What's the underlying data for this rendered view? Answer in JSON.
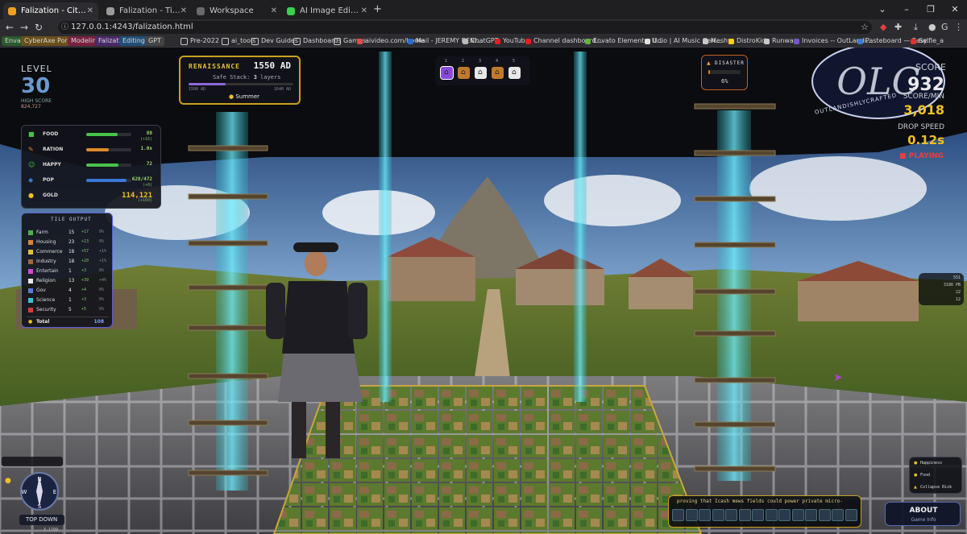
{
  "browser": {
    "tabs": [
      {
        "title": "Falization - City Builder v0.",
        "active": true,
        "favicon_color": "#f0a020"
      },
      {
        "title": "Falization - Tile Manager v1.3.1",
        "active": false,
        "favicon_color": "#9a9a9a"
      },
      {
        "title": "Workspace",
        "active": false,
        "favicon_color": "#6a6a6a"
      },
      {
        "title": "AI Image Editor - Transform & ",
        "active": false,
        "favicon_color": "#37d14a"
      }
    ],
    "new_tab": "+",
    "url": "127.0.0.1:4243/falization.html",
    "window_controls": [
      "⌄",
      "–",
      "❐",
      "✕"
    ],
    "bookmarks": [
      {
        "label": "Envato",
        "style": "chip",
        "color": "#2a5a2a"
      },
      {
        "label": "CyberAxe Portfolio",
        "style": "chip",
        "color": "#6b4f1a"
      },
      {
        "label": "Modeling",
        "style": "chip",
        "color": "#7a2040"
      },
      {
        "label": "Falization",
        "style": "chip",
        "color": "#4a2a6a"
      },
      {
        "label": "Editing",
        "style": "chip",
        "color": "#1f4f7a"
      },
      {
        "label": "GPT",
        "style": "chip",
        "color": "#444"
      },
      {
        "label": "Pre-2022",
        "style": "folder",
        "color": "#c9c9c9"
      },
      {
        "label": "ai_tools",
        "style": "folder",
        "color": "#c9c9c9"
      },
      {
        "label": "Dev Guides",
        "style": "folder",
        "color": "#c9c9c9"
      },
      {
        "label": "Dashboards",
        "style": "folder",
        "color": "#c9c9c9"
      },
      {
        "label": "Games",
        "style": "folder",
        "color": "#c9c9c9"
      },
      {
        "label": "aivideo.com/home",
        "style": "link",
        "color": "#e14b4b"
      },
      {
        "label": "Mail - JEREMY BENI...",
        "style": "link",
        "color": "#2a6bd1"
      },
      {
        "label": "ChatGPT",
        "style": "link",
        "color": "#bbbbbb"
      },
      {
        "label": "YouTube",
        "style": "link",
        "color": "#e02020"
      },
      {
        "label": "Channel dashboard...",
        "style": "link",
        "color": "#e02020"
      },
      {
        "label": "Envato Elements: U...",
        "style": "link",
        "color": "#62b33a"
      },
      {
        "label": "Udio | AI Music Gen...",
        "style": "link",
        "color": "#e0e0e0"
      },
      {
        "label": "Meshy",
        "style": "link",
        "color": "#c9c9c9"
      },
      {
        "label": "DistroKid",
        "style": "link",
        "color": "#ffd400"
      },
      {
        "label": "Runway",
        "style": "link",
        "color": "#c9c9c9"
      },
      {
        "label": "Invoices -- OutLandi...",
        "style": "link",
        "color": "#7a52d0"
      },
      {
        "label": "Pasteboard — Easy...",
        "style": "link",
        "color": "#3a7bd5"
      },
      {
        "label": "Selfie_a",
        "style": "link",
        "color": "#e03030"
      }
    ]
  },
  "game": {
    "level": {
      "label": "LEVEL",
      "value": "30",
      "sub1": "HIGH SCORE",
      "sub2": "824,727"
    },
    "era": {
      "name": "RENAISSANCE",
      "year": "1550 AD",
      "safe_label": "Safe Stack:",
      "safe_value": "3",
      "safe_unit": "layers",
      "range_start": "1500 AD",
      "range_end": "1640 AD",
      "progress": 0.35,
      "season": "Summer"
    },
    "hotbar": {
      "numbers": [
        "1",
        "2",
        "3",
        "4",
        "5"
      ],
      "selected": 0
    },
    "disaster": {
      "label": "DISASTER",
      "value": "6%",
      "progress": 0.06
    },
    "score": {
      "label": "SCORE",
      "value": "932",
      "per_min_label": "SCORE/MIN",
      "per_min": "3,018",
      "drop_label": "DROP SPEED",
      "drop": "0.12s",
      "status": "PLAYING"
    },
    "resources": [
      {
        "icon": "food-icon",
        "label": "FOOD",
        "value": "88",
        "rate": "(+16)",
        "fill": 0.7,
        "color": "#49c24a"
      },
      {
        "icon": "ration-icon",
        "label": "RATION",
        "value": "1.0x",
        "rate": "",
        "fill": 0.5,
        "color": "#e08a2a"
      },
      {
        "icon": "happy-icon",
        "label": "HAPPY",
        "value": "72",
        "rate": "",
        "fill": 0.72,
        "color": "#49c24a"
      },
      {
        "icon": "pop-icon",
        "label": "POP",
        "value": "628/472",
        "rate": "(+8)",
        "fill": 0.9,
        "color": "#3a78d8"
      },
      {
        "icon": "gold-icon",
        "label": "GOLD",
        "value": "114,121",
        "rate": "(+169)",
        "fill": 0,
        "color": "#f0c020"
      }
    ],
    "tile_output": {
      "title": "TILE OUTPUT",
      "rows": [
        {
          "name": "Farm",
          "count": "15",
          "a": "+17",
          "b": "0%",
          "color": "#4caf50"
        },
        {
          "name": "Housing",
          "count": "23",
          "a": "+13",
          "b": "0%",
          "color": "#d9843a"
        },
        {
          "name": "Commerce",
          "count": "18",
          "a": "+57",
          "b": "+1%",
          "color": "#e0c03a"
        },
        {
          "name": "Industry",
          "count": "18",
          "a": "+20",
          "b": "+1%",
          "color": "#9a6a3a"
        },
        {
          "name": "Entertain",
          "count": "1",
          "a": "+3",
          "b": "0%",
          "color": "#d04ad0"
        },
        {
          "name": "Religion",
          "count": "13",
          "a": "+39",
          "b": "+4%",
          "color": "#e8e8e8"
        },
        {
          "name": "Gov",
          "count": "4",
          "a": "+4",
          "b": "0%",
          "color": "#5a7ad8"
        },
        {
          "name": "Science",
          "count": "1",
          "a": "+3",
          "b": "0%",
          "color": "#3ac0d0"
        },
        {
          "name": "Security",
          "count": "5",
          "a": "+5",
          "b": "0%",
          "color": "#d83a3a"
        }
      ],
      "total_label": "Total",
      "total_value": "108"
    },
    "minimap": {
      "coords": "x 142",
      "blocks": "3186 PB",
      "line1": "551",
      "line2": "3186 PB",
      "line3": "22",
      "line4": "12"
    },
    "camera": {
      "top_down": "TOP DOWN",
      "compass": [
        "N",
        "E",
        "S",
        "W"
      ],
      "coord": "X-1799"
    },
    "objectives": [
      "Happiness",
      "Food",
      "Collapse Risk"
    ],
    "ticker": "proving that Icash mews fields could power private micro-",
    "about": {
      "title": "ABOUT",
      "sub": "Game Info"
    },
    "watermark": {
      "brand": "OLC",
      "tagline": "OUTLANDISHLYCRAFTED"
    }
  }
}
